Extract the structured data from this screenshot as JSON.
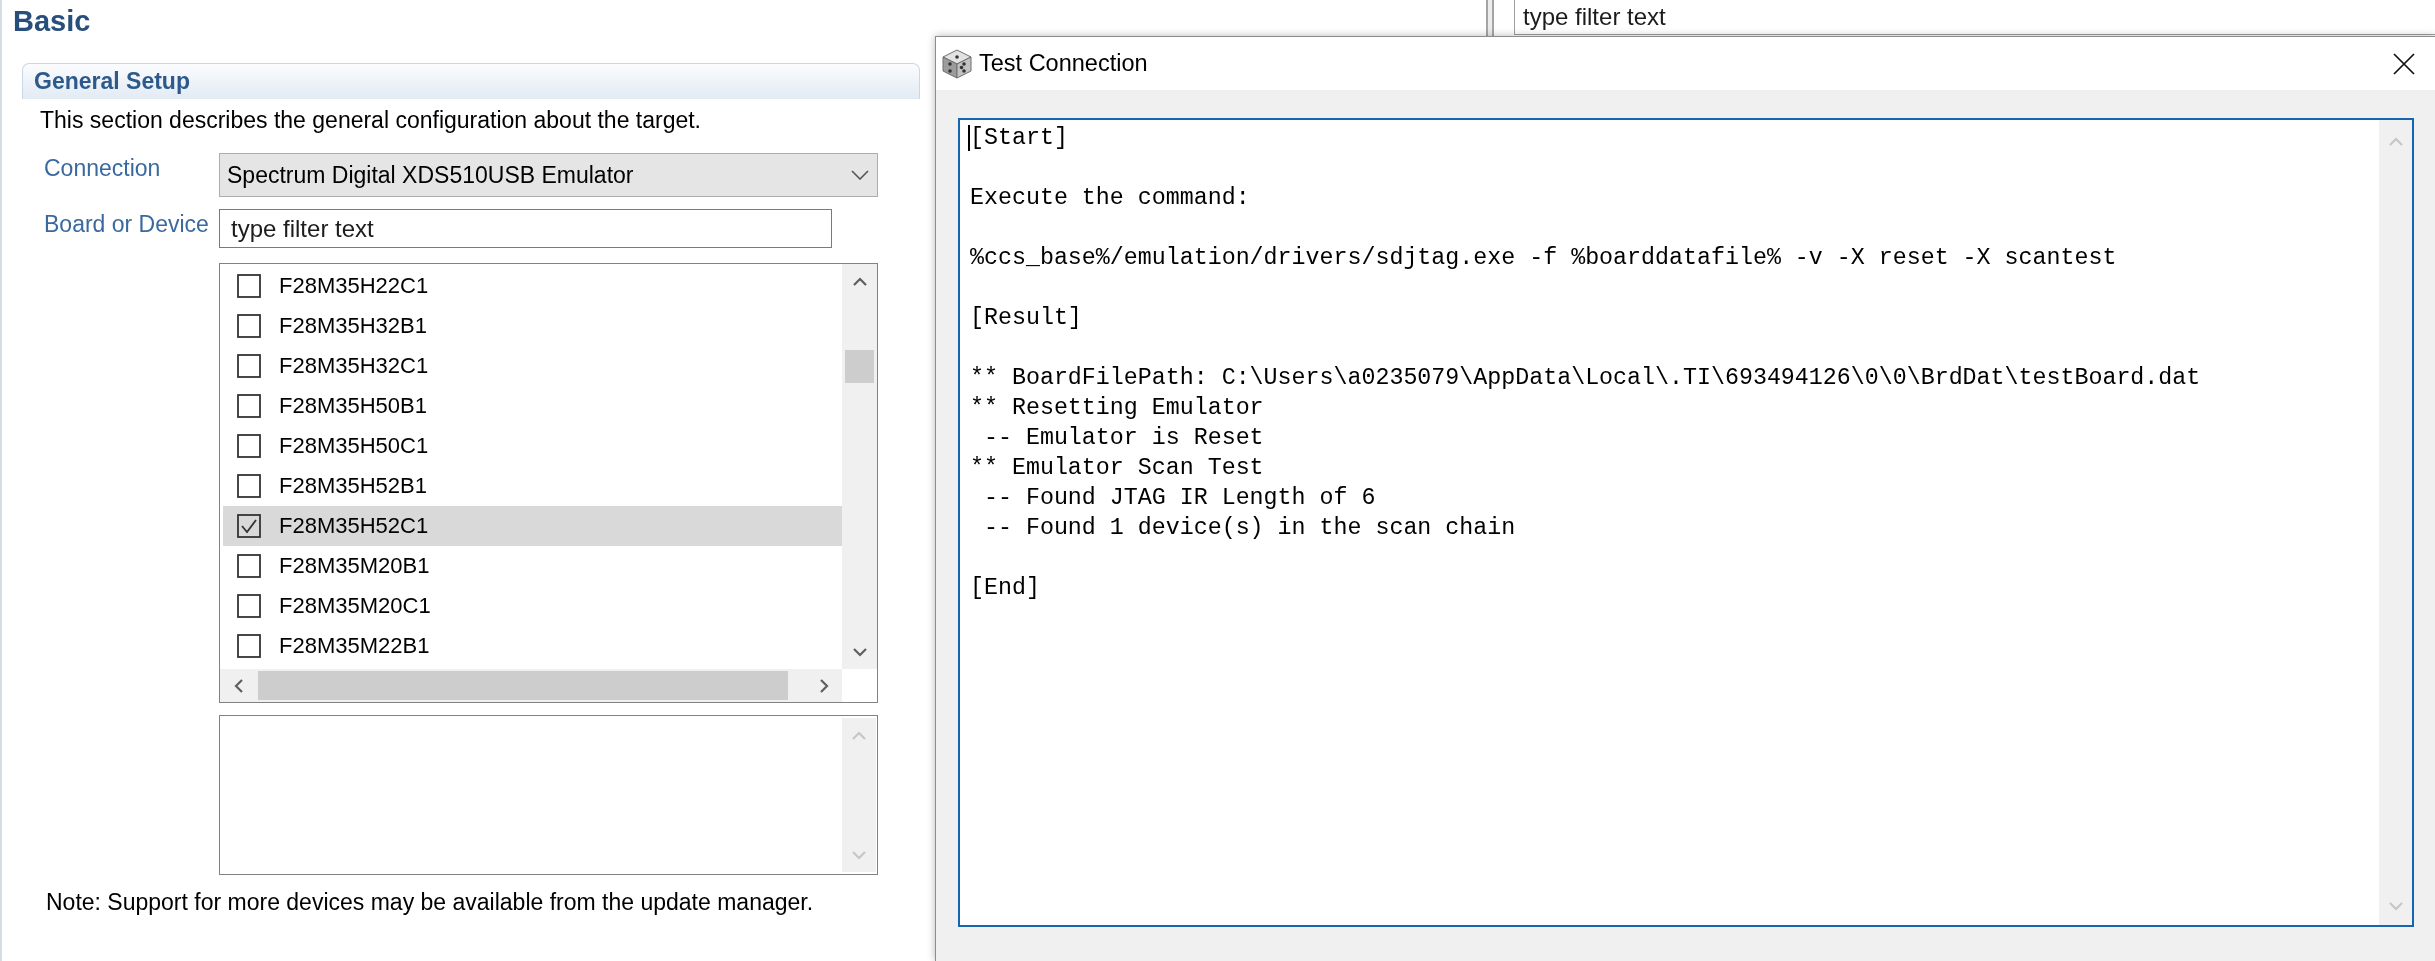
{
  "editor": {
    "title": "Basic",
    "section": {
      "title": "General Setup",
      "description": "This section describes the general configuration about the target.",
      "connection": {
        "label": "Connection",
        "value": "Spectrum Digital XDS510USB Emulator"
      },
      "board_or_device": {
        "label": "Board or Device",
        "filter": {
          "placeholder": "type filter text"
        },
        "devices": [
          {
            "name": "F28M35H22C1",
            "checked": false,
            "selected": false
          },
          {
            "name": "F28M35H32B1",
            "checked": false,
            "selected": false
          },
          {
            "name": "F28M35H32C1",
            "checked": false,
            "selected": false
          },
          {
            "name": "F28M35H50B1",
            "checked": false,
            "selected": false
          },
          {
            "name": "F28M35H50C1",
            "checked": false,
            "selected": false
          },
          {
            "name": "F28M35H52B1",
            "checked": false,
            "selected": false
          },
          {
            "name": "F28M35H52C1",
            "checked": true,
            "selected": true
          },
          {
            "name": "F28M35M20B1",
            "checked": false,
            "selected": false
          },
          {
            "name": "F28M35M20C1",
            "checked": false,
            "selected": false
          },
          {
            "name": "F28M35M22B1",
            "checked": false,
            "selected": false
          }
        ]
      },
      "note": "Note: Support for more devices may be available from the update manager."
    }
  },
  "side_panel": {
    "filter": {
      "placeholder": "type filter text"
    }
  },
  "dialog": {
    "title": "Test Connection",
    "output": {
      "focused": true,
      "paragraphs": [
        [
          "[Start]"
        ],
        [
          "Execute the command:"
        ],
        [
          "%ccs_base%/emulation/drivers/sdjtag.exe -f %boarddatafile% -v -X reset -X scantest"
        ],
        [
          "[Result]"
        ],
        [
          "** BoardFilePath: C:\\Users\\a0235079\\AppData\\Local\\.TI\\693494126\\0\\0\\BrdDat\\testBoard.dat",
          "** Resetting Emulator",
          " -- Emulator is Reset",
          "** Emulator Scan Test",
          " -- Found JTAG IR Length of 6",
          " -- Found 1 device(s) in the scan chain"
        ],
        [
          "[End]"
        ]
      ]
    }
  }
}
